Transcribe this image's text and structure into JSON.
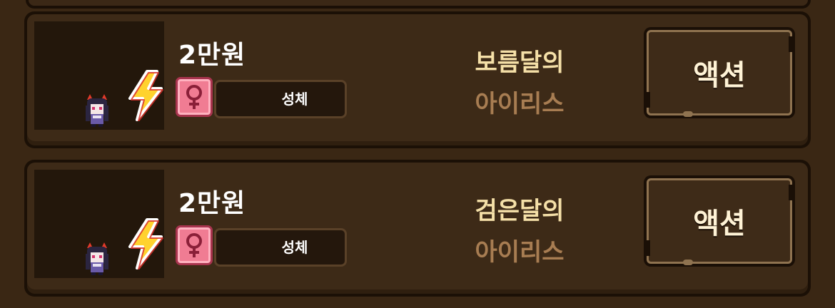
{
  "colors": {
    "background": "#3a2714",
    "card": "#3d2a17",
    "name_primary": "#f5e0a8",
    "name_secondary": "#a87d52",
    "female_badge": "#f07c93",
    "bolt": "#ffd22e"
  },
  "cards": [
    {
      "price": "2만원",
      "attribute_icon": "female-symbol-icon",
      "attribute_label": "성체",
      "element_icon": "lightning-bolt-icon",
      "name_line1": "보름달의",
      "name_line2": "아이리스",
      "action_label": "액션"
    },
    {
      "price": "2만원",
      "attribute_icon": "female-symbol-icon",
      "attribute_label": "성체",
      "element_icon": "lightning-bolt-icon",
      "name_line1": "검은달의",
      "name_line2": "아이리스",
      "action_label": "액션"
    }
  ]
}
